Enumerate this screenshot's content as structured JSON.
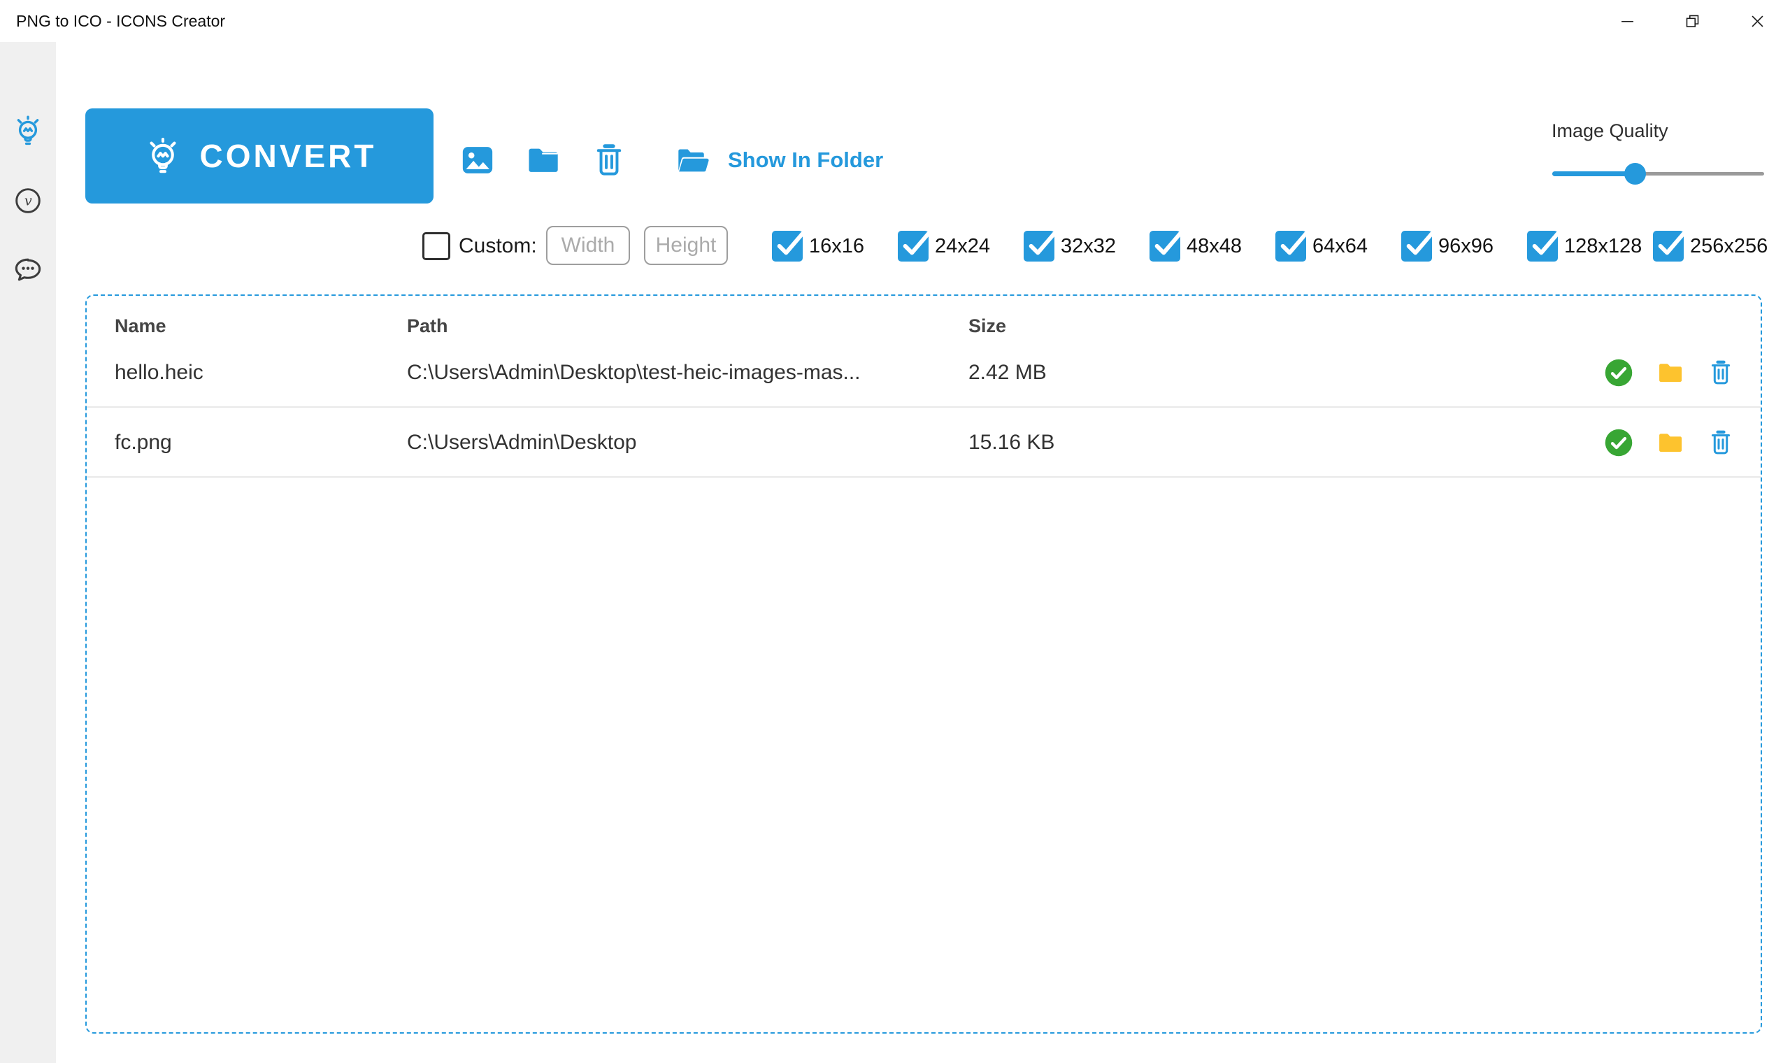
{
  "window": {
    "title": "PNG to ICO - ICONS Creator",
    "controls": {
      "minimize": "minimize",
      "restore": "restore",
      "close": "close"
    }
  },
  "sidebar": {
    "items": [
      {
        "icon": "lightbulb-icon",
        "name": "converter"
      },
      {
        "icon": "version-icon",
        "name": "version"
      },
      {
        "icon": "feedback-icon",
        "name": "feedback"
      }
    ]
  },
  "toolbar": {
    "convert_label": "CONVERT",
    "icons": [
      "add-image-icon",
      "add-folder-icon",
      "trash-icon"
    ],
    "show_in_folder_label": "Show In Folder"
  },
  "image_quality": {
    "label": "Image Quality",
    "value_percent": 39
  },
  "options": {
    "custom_label": "Custom:",
    "custom_checked": false,
    "width_placeholder": "Width",
    "height_placeholder": "Height"
  },
  "sizes": [
    {
      "label": "16x16",
      "checked": true
    },
    {
      "label": "24x24",
      "checked": true
    },
    {
      "label": "32x32",
      "checked": true
    },
    {
      "label": "48x48",
      "checked": true
    },
    {
      "label": "64x64",
      "checked": true
    },
    {
      "label": "96x96",
      "checked": true
    },
    {
      "label": "128x128",
      "checked": true
    },
    {
      "label": "256x256",
      "checked": true
    }
  ],
  "table": {
    "headers": {
      "name": "Name",
      "path": "Path",
      "size": "Size"
    },
    "rows": [
      {
        "name": "hello.heic",
        "path": "C:\\Users\\Admin\\Desktop\\test-heic-images-mas...",
        "size": "2.42 MB",
        "status": "converted"
      },
      {
        "name": "fc.png",
        "path": "C:\\Users\\Admin\\Desktop",
        "size": "15.16 KB",
        "status": "converted"
      }
    ]
  },
  "colors": {
    "accent": "#2599DC",
    "green": "#38A634",
    "yellow": "#FDC32E"
  }
}
